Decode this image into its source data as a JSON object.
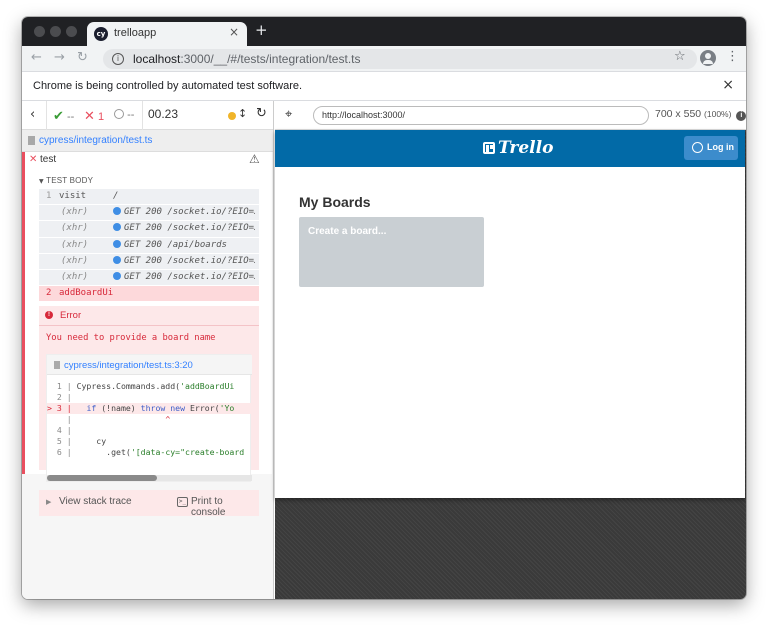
{
  "browser": {
    "tab_title": "trelloapp",
    "tab_favicon": "cy",
    "url_host": "localhost",
    "url_path": ":3000/__/#/tests/integration/test.ts",
    "infobar_text": "Chrome is being controlled by automated test software."
  },
  "reporter": {
    "passed": "--",
    "failed": "1",
    "pending": "--",
    "duration": "00.23",
    "spec_file": "cypress/integration/test.ts",
    "test_name": "test",
    "hook_label": "TEST BODY",
    "commands": [
      {
        "num": "1",
        "name": "visit",
        "message": "/"
      },
      {
        "num": "",
        "name": "(xhr)",
        "message": "GET 200 /socket.io/?EIO=3&…"
      },
      {
        "num": "",
        "name": "(xhr)",
        "message": "GET 200 /socket.io/?EIO=3&…"
      },
      {
        "num": "",
        "name": "(xhr)",
        "message": "GET 200 /api/boards"
      },
      {
        "num": "",
        "name": "(xhr)",
        "message": "GET 200 /socket.io/?EIO=3&…"
      },
      {
        "num": "",
        "name": "(xhr)",
        "message": "GET 200 /socket.io/?EIO=3&…"
      },
      {
        "num": "2",
        "name": "addBoardUi",
        "message": ""
      }
    ],
    "error": {
      "title": "Error",
      "message": "You need to provide a board name",
      "code_file": "cypress/integration/test.ts:3:20",
      "code_lines": {
        "l1_ln": "  1 | ",
        "l1_code": "Cypress.Commands.add(",
        "l1_str": "'addBoardUi",
        "l2_ln": "  2 | ",
        "l3_ln": "> 3 | ",
        "l3_kw1": "if",
        "l3_mid": " (!name) ",
        "l3_kw2": "throw new",
        "l3_fn": " Error(",
        "l3_str": "'Yo",
        "l4_ln": "    | ",
        "l4_caret": "^",
        "l5_ln": "  4 | ",
        "l6_ln": "  5 | ",
        "l6_code": "    cy",
        "l7_ln": "  6 | ",
        "l7_code": "      .get(",
        "l7_str": "'[data-cy=\"create-board"
      },
      "stack_label": "View stack trace",
      "print_label": "Print to console",
      "console_icon": ">_"
    }
  },
  "aut": {
    "url": "http://localhost:3000/",
    "viewport": "700 x 550",
    "scale": "(100%)",
    "logo_text": "Trello",
    "login_label": "Log in",
    "boards_title": "My Boards",
    "create_board_label": "Create a board..."
  },
  "colors": {
    "trello_blue": "#026aa7",
    "fail_red": "#e94f5f",
    "pass_green": "#3a9c36",
    "link_blue": "#3380ff"
  }
}
